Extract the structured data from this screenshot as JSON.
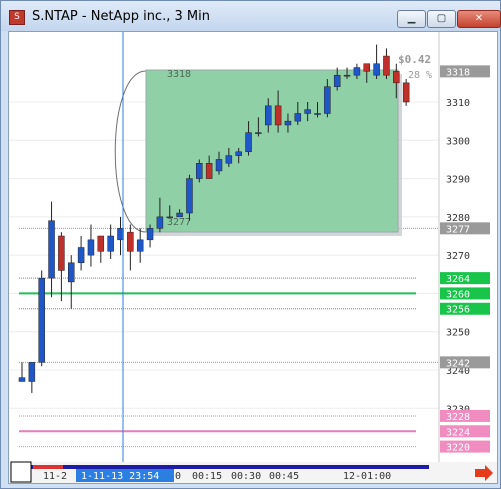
{
  "window": {
    "title": "S.NTAP - NetApp inc., 3 Min",
    "buttons": {
      "minimize": "▁",
      "maximize": "▢",
      "close": "✕"
    }
  },
  "price_axis": {
    "ticks": [
      "3310",
      "3300",
      "3290",
      "3280",
      "3270",
      "3260",
      "3250",
      "3240",
      "3230"
    ],
    "badges": [
      {
        "label": "3318",
        "kind": "gray"
      },
      {
        "label": "3277",
        "kind": "gray"
      },
      {
        "label": "3264",
        "kind": "green"
      },
      {
        "label": "3260",
        "kind": "green"
      },
      {
        "label": "3256",
        "kind": "green"
      },
      {
        "label": "3242",
        "kind": "gray"
      },
      {
        "label": "3228",
        "kind": "pink"
      },
      {
        "label": "3224",
        "kind": "pink"
      },
      {
        "label": "3220",
        "kind": "pink"
      }
    ]
  },
  "measure_box": {
    "high_label": "3318",
    "low_label": "3277",
    "change": "$0.42",
    "change_pct": "28 %"
  },
  "time_axis": {
    "labels": [
      "11-2",
      "0",
      "00:15",
      "00:30",
      "00:45",
      "12-01:00"
    ],
    "crosshair_label": "1-11-13 23:54"
  },
  "levels": {
    "green": [
      3264,
      3260,
      3256
    ],
    "pink": [
      3228,
      3224,
      3220
    ],
    "gray": [
      3242,
      3277
    ]
  },
  "chart_data": {
    "type": "candlestick",
    "y_unit": "price",
    "ylim": [
      3225,
      3326
    ],
    "candles": [
      {
        "o": 3237,
        "h": 3242,
        "l": 3238,
        "c": 3238,
        "color": "blue"
      },
      {
        "o": 3237,
        "h": 3242,
        "l": 3234,
        "c": 3242,
        "color": "blue"
      },
      {
        "o": 3242,
        "h": 3266,
        "l": 3241,
        "c": 3264,
        "color": "blue"
      },
      {
        "o": 3264,
        "h": 3284,
        "l": 3259,
        "c": 3279,
        "color": "blue"
      },
      {
        "o": 3275,
        "h": 3276,
        "l": 3258,
        "c": 3266,
        "color": "red"
      },
      {
        "o": 3263,
        "h": 3270,
        "l": 3256,
        "c": 3268,
        "color": "blue"
      },
      {
        "o": 3268,
        "h": 3275,
        "l": 3266,
        "c": 3272,
        "color": "blue"
      },
      {
        "o": 3270,
        "h": 3278,
        "l": 3267,
        "c": 3274,
        "color": "blue"
      },
      {
        "o": 3275,
        "h": 3272,
        "l": 3268,
        "c": 3271,
        "color": "red"
      },
      {
        "o": 3271,
        "h": 3278,
        "l": 3269,
        "c": 3275,
        "color": "blue"
      },
      {
        "o": 3274,
        "h": 3280,
        "l": 3270,
        "c": 3277,
        "color": "blue"
      },
      {
        "o": 3276,
        "h": 3278,
        "l": 3266,
        "c": 3271,
        "color": "red"
      },
      {
        "o": 3271,
        "h": 3277,
        "l": 3268,
        "c": 3274,
        "color": "blue"
      },
      {
        "o": 3274,
        "h": 3278,
        "l": 3272,
        "c": 3277,
        "color": "blue"
      },
      {
        "o": 3277,
        "h": 3285,
        "l": 3276,
        "c": 3280,
        "color": "blue"
      },
      {
        "o": 3280,
        "h": 3283,
        "l": 3280,
        "c": 3280,
        "color": "blue"
      },
      {
        "o": 3280,
        "h": 3282,
        "l": 3280,
        "c": 3281,
        "color": "blue"
      },
      {
        "o": 3281,
        "h": 3291,
        "l": 3279,
        "c": 3290,
        "color": "blue"
      },
      {
        "o": 3290,
        "h": 3295,
        "l": 3289,
        "c": 3294,
        "color": "blue"
      },
      {
        "o": 3294,
        "h": 3296,
        "l": 3290,
        "c": 3290,
        "color": "red"
      },
      {
        "o": 3292,
        "h": 3297,
        "l": 3291,
        "c": 3295,
        "color": "blue"
      },
      {
        "o": 3294,
        "h": 3298,
        "l": 3293,
        "c": 3296,
        "color": "blue"
      },
      {
        "o": 3296,
        "h": 3298,
        "l": 3294,
        "c": 3297,
        "color": "blue"
      },
      {
        "o": 3297,
        "h": 3305,
        "l": 3296,
        "c": 3302,
        "color": "blue"
      },
      {
        "o": 3302,
        "h": 3306,
        "l": 3301,
        "c": 3302,
        "color": "blue"
      },
      {
        "o": 3304,
        "h": 3311,
        "l": 3302,
        "c": 3309,
        "color": "blue"
      },
      {
        "o": 3309,
        "h": 3313,
        "l": 3302,
        "c": 3304,
        "color": "red"
      },
      {
        "o": 3304,
        "h": 3307,
        "l": 3302,
        "c": 3305,
        "color": "blue"
      },
      {
        "o": 3305,
        "h": 3310,
        "l": 3304,
        "c": 3307,
        "color": "blue"
      },
      {
        "o": 3307,
        "h": 3310,
        "l": 3305,
        "c": 3308,
        "color": "blue"
      },
      {
        "o": 3307,
        "h": 3310,
        "l": 3306,
        "c": 3307,
        "color": "blue"
      },
      {
        "o": 3307,
        "h": 3316,
        "l": 3306,
        "c": 3314,
        "color": "blue"
      },
      {
        "o": 3314,
        "h": 3319,
        "l": 3313,
        "c": 3317,
        "color": "blue"
      },
      {
        "o": 3317,
        "h": 3319,
        "l": 3316,
        "c": 3317,
        "color": "blue"
      },
      {
        "o": 3317,
        "h": 3320,
        "l": 3316,
        "c": 3319,
        "color": "blue"
      },
      {
        "o": 3320,
        "h": 3320,
        "l": 3315,
        "c": 3318,
        "color": "red"
      },
      {
        "o": 3317,
        "h": 3325,
        "l": 3316,
        "c": 3320,
        "color": "blue"
      },
      {
        "o": 3322,
        "h": 3324,
        "l": 3316,
        "c": 3317,
        "color": "red"
      },
      {
        "o": 3318,
        "h": 3320,
        "l": 3311,
        "c": 3315,
        "color": "red"
      },
      {
        "o": 3315,
        "h": 3316,
        "l": 3309,
        "c": 3310,
        "color": "red"
      }
    ]
  },
  "colors": {
    "bull": "#1f57c8",
    "bear": "#c0302a",
    "measure_fill": "#8fd0a7",
    "green_level": "#1fbf52",
    "pink_level": "#e37fb7",
    "crosshair": "#2a7fe0",
    "arrow": "#e53a1c"
  }
}
